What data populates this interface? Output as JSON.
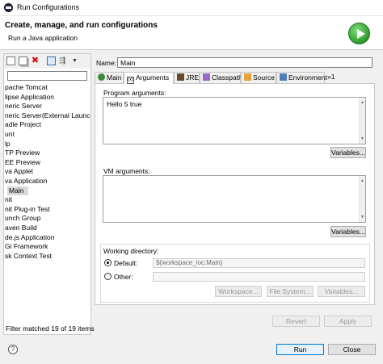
{
  "window": {
    "title": "Run Configurations"
  },
  "header": {
    "title": "Create, manage, and run configurations",
    "subtitle": "Run a Java application"
  },
  "left": {
    "filter_value": "",
    "tree": [
      "pache Tomcat",
      "lipse Application",
      "neric Server",
      "neric Server(External Launch)",
      "adle Project",
      "unt",
      "lp",
      "TP Preview",
      "EE Preview",
      "va Applet",
      "va Application",
      "Main",
      "nit",
      "nit Plug-in Test",
      "unch Group",
      "aven Build",
      "de.js Application",
      "Gi Framework",
      "sk Context Test"
    ],
    "selected_index": 11,
    "filter_status": "Filter matched 19 of 19 items"
  },
  "name": {
    "label": "Name:",
    "value": "Main"
  },
  "tabs": [
    {
      "label": "Main",
      "icon": "java-class-icon"
    },
    {
      "label": "Arguments",
      "icon": "arguments-icon"
    },
    {
      "label": "JRE",
      "icon": "jre-icon"
    },
    {
      "label": "Classpath",
      "icon": "classpath-icon"
    },
    {
      "label": "Source",
      "icon": "source-icon"
    },
    {
      "label": "Environment",
      "icon": "environment-icon"
    },
    {
      "label": "»1",
      "icon": ""
    }
  ],
  "active_tab": "Arguments",
  "arguments": {
    "program_label": "Program arguments:",
    "program_value": "Hello 5 true",
    "variables_label": "Variables...",
    "vm_label": "VM arguments:",
    "vm_value": "",
    "vm_variables_label": "Variables..."
  },
  "workdir": {
    "label": "Working directory:",
    "default_label": "Default:",
    "default_value": "${workspace_loc:Main}",
    "other_label": "Other:",
    "other_value": "",
    "workspace_btn": "Workspace...",
    "filesystem_btn": "File System...",
    "variables_btn": "Variables..."
  },
  "footer": {
    "revert": "Revert",
    "apply": "Apply",
    "run": "Run",
    "close": "Close",
    "help": "?"
  },
  "colors": {
    "run_icon": "#2f9a2c",
    "primary_border": "#0078d7"
  }
}
